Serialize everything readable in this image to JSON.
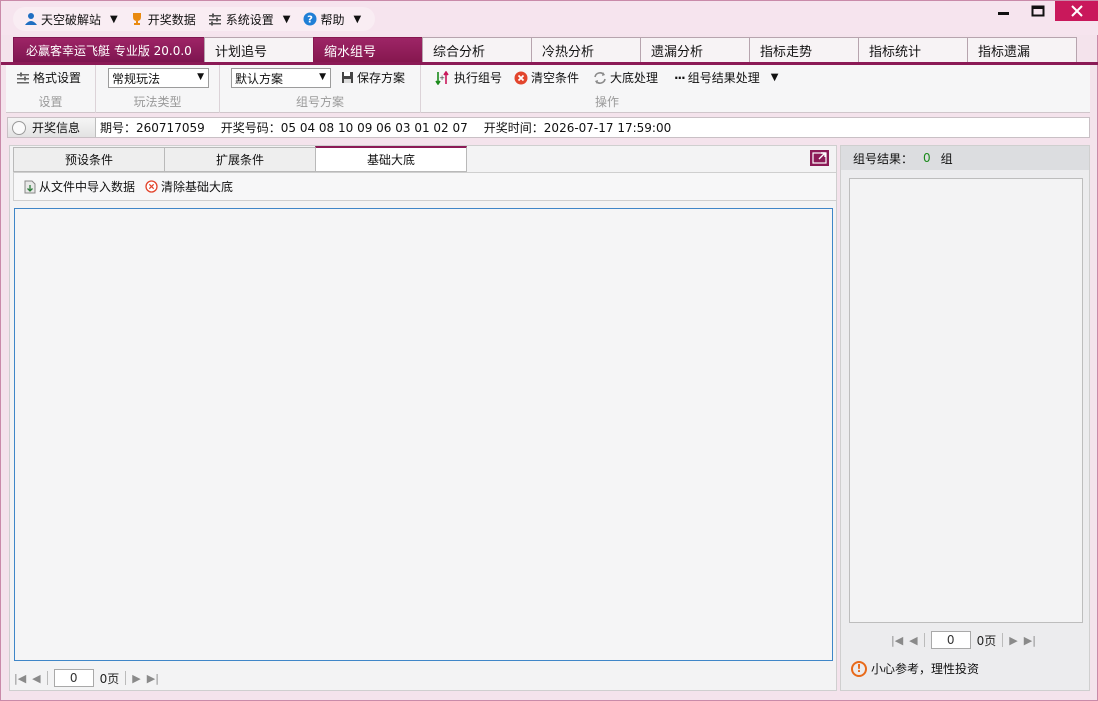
{
  "menu": {
    "items": [
      {
        "label": "天空破解站",
        "icon": "user-icon",
        "caret": true
      },
      {
        "label": "开奖数据",
        "icon": "trophy-icon",
        "caret": false
      },
      {
        "label": "系统设置",
        "icon": "sliders-icon",
        "caret": true
      },
      {
        "label": "帮助",
        "icon": "help-icon",
        "caret": true
      }
    ]
  },
  "tabs": {
    "brand": "必赢客幸运飞艇 专业版 20.0.0",
    "items": [
      "计划追号",
      "缩水组号",
      "综合分析",
      "冷热分析",
      "遗漏分析",
      "指标走势",
      "指标统计",
      "指标遗漏"
    ],
    "active_index": 1
  },
  "toolbar": {
    "format_settings": "格式设置",
    "group_settings": "设置",
    "play_type_value": "常规玩法",
    "group_play_type": "玩法类型",
    "scheme_value": "默认方案",
    "save_scheme": "保存方案",
    "group_scheme": "组号方案",
    "execute": "执行组号",
    "clear_conditions": "清空条件",
    "base_process": "大底处理",
    "result_process": "组号结果处理",
    "group_operation": "操作"
  },
  "info": {
    "button": "开奖信息",
    "issue_label": "期号：",
    "issue": "260717059",
    "numbers_label": "开奖号码：",
    "numbers": "05 04 08 10 09 06 03 01 02 07",
    "time_label": "开奖时间：",
    "time": "2026-07-17 17:59:00"
  },
  "left": {
    "subtabs": [
      "预设条件",
      "扩展条件",
      "基础大底"
    ],
    "active_subtab": 2,
    "import_label": "从文件中导入数据",
    "clear_base_label": "清除基础大底",
    "pager": {
      "value": "0",
      "label": "0页"
    }
  },
  "right": {
    "result_label": "组号结果：",
    "result_count": "0",
    "result_unit": "组",
    "pager": {
      "value": "0",
      "label": "0页"
    },
    "warning": "小心参考，理性投资"
  },
  "colors": {
    "brand": "#8b1a56",
    "close": "#c9185b",
    "count": "#1b8a1b",
    "warning": "#e86a1a"
  }
}
